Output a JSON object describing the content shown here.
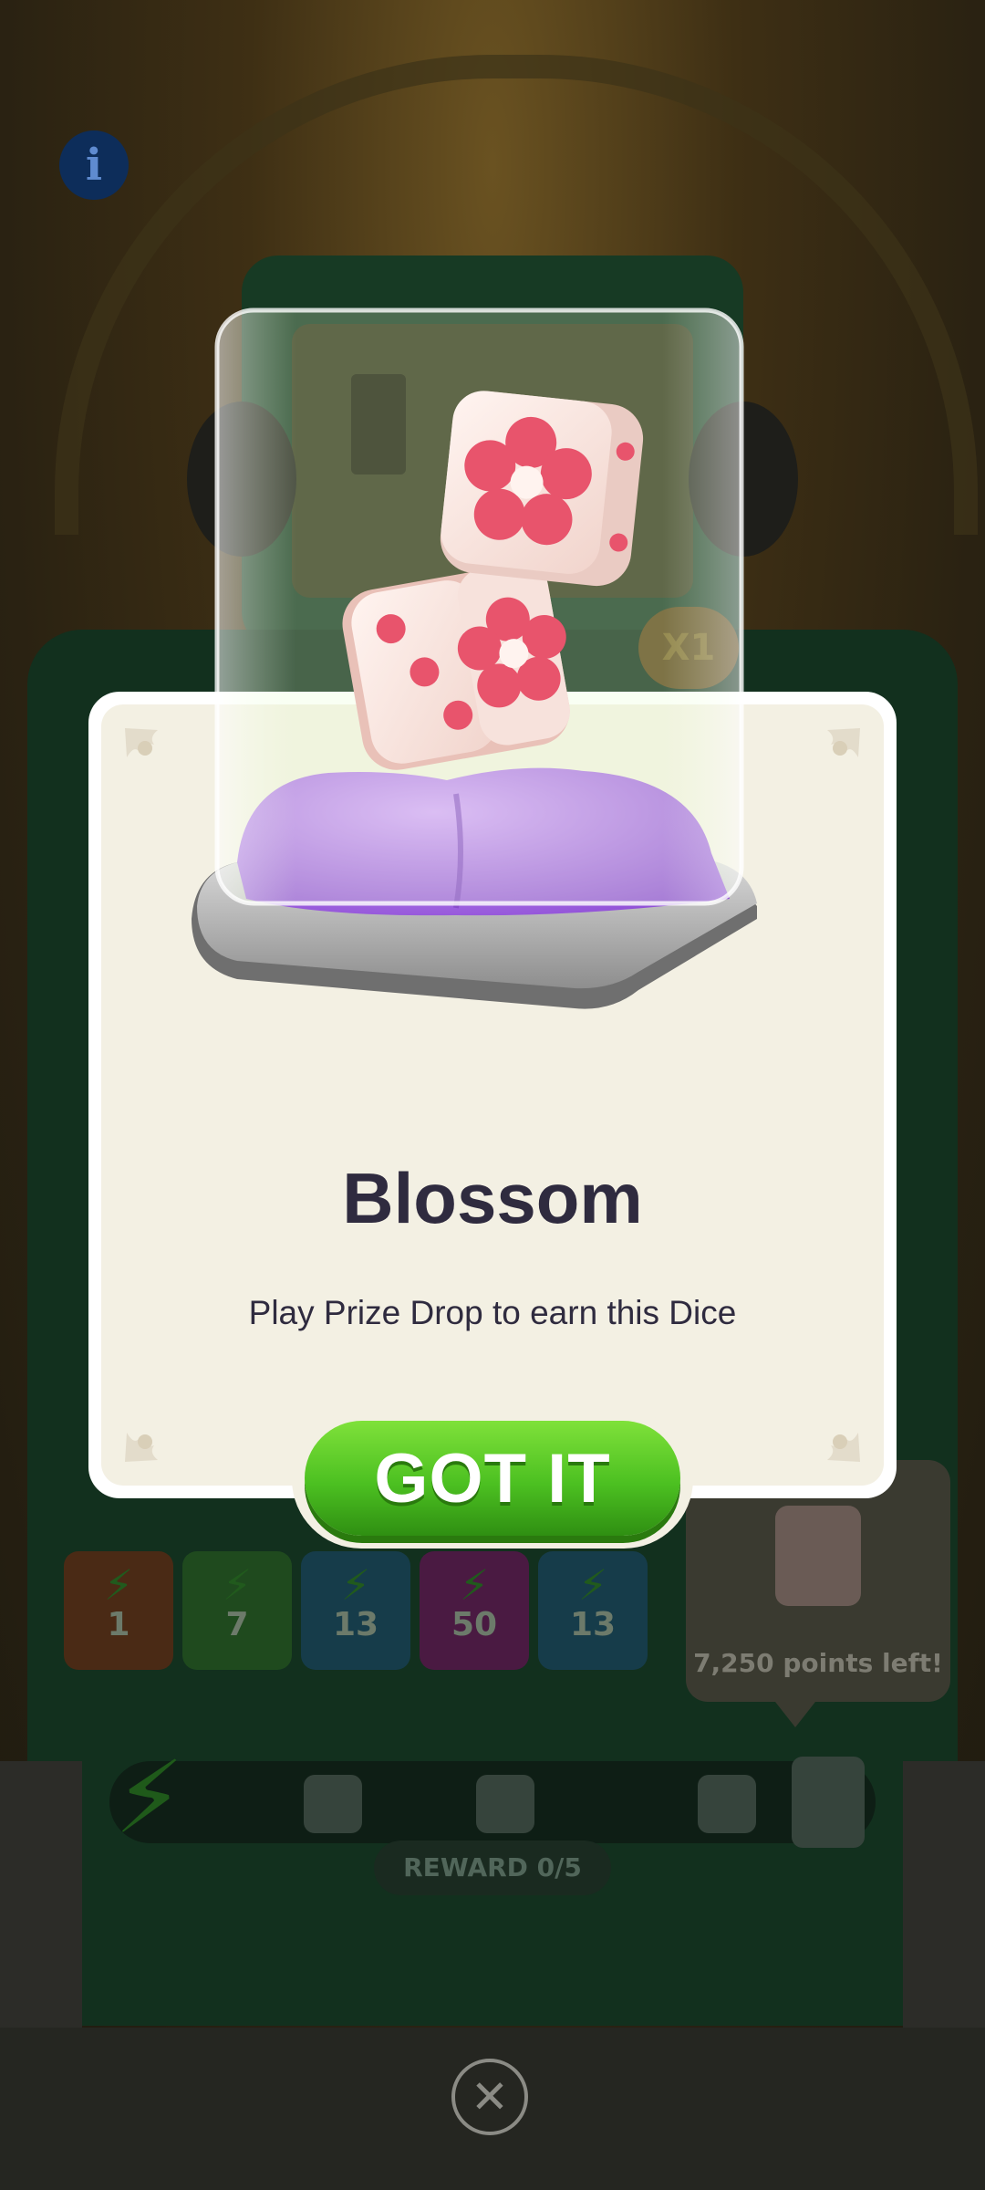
{
  "background": {
    "info_icon_glyph": "i",
    "multiplier_chip": "X1",
    "slots": [
      {
        "value": "1",
        "color": "#4a2a15"
      },
      {
        "value": "7",
        "color": "#1f4a1e"
      },
      {
        "value": "13",
        "color": "#163c4a"
      },
      {
        "value": "50",
        "color": "#4a1a42"
      },
      {
        "value": "13",
        "color": "#163c4a"
      }
    ],
    "points_tooltip": "7,250 points left!",
    "reward_progress": "REWARD 0/5"
  },
  "modal": {
    "title": "Blossom",
    "subtitle": "Play Prize Drop to earn this Dice",
    "button_label": "GOT IT",
    "colors": {
      "button": "#4cc021",
      "card": "#f3f0e3",
      "dice_pip": "#e8546c",
      "cushion": "#a865e8"
    }
  },
  "close_icon": "close-icon"
}
